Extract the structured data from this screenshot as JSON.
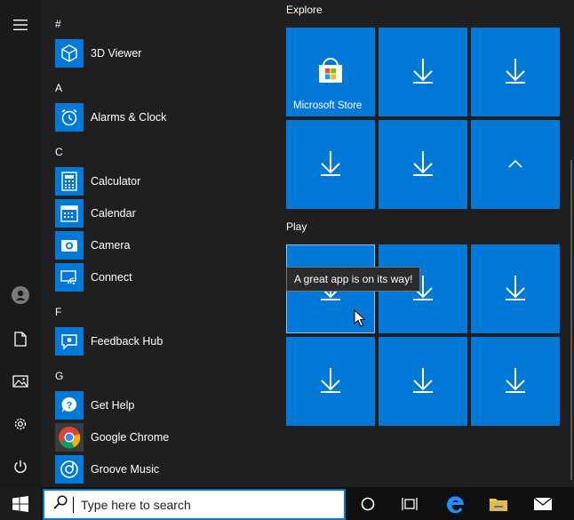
{
  "left_rail": {
    "items": [
      {
        "name": "hamburger-menu-icon"
      },
      {
        "name": "user-avatar-icon"
      },
      {
        "name": "documents-icon"
      },
      {
        "name": "pictures-icon"
      },
      {
        "name": "settings-icon"
      },
      {
        "name": "power-icon"
      }
    ]
  },
  "app_list": {
    "groups": [
      {
        "letter": "#",
        "apps": [
          {
            "label": "3D Viewer",
            "icon": "cube-icon"
          }
        ]
      },
      {
        "letter": "A",
        "apps": [
          {
            "label": "Alarms & Clock",
            "icon": "alarm-clock-icon"
          }
        ]
      },
      {
        "letter": "C",
        "apps": [
          {
            "label": "Calculator",
            "icon": "calculator-icon"
          },
          {
            "label": "Calendar",
            "icon": "calendar-icon"
          },
          {
            "label": "Camera",
            "icon": "camera-icon"
          },
          {
            "label": "Connect",
            "icon": "connect-icon"
          }
        ]
      },
      {
        "letter": "F",
        "apps": [
          {
            "label": "Feedback Hub",
            "icon": "feedback-icon"
          }
        ]
      },
      {
        "letter": "G",
        "apps": [
          {
            "label": "Get Help",
            "icon": "help-icon"
          },
          {
            "label": "Google Chrome",
            "icon": "chrome-icon"
          },
          {
            "label": "Groove Music",
            "icon": "music-icon"
          }
        ]
      }
    ]
  },
  "tiles": {
    "explore": {
      "title": "Explore",
      "items": [
        {
          "label": "Microsoft Store",
          "icon": "store-icon"
        },
        {
          "label": "",
          "icon": "download-arrow-icon"
        },
        {
          "label": "",
          "icon": "download-arrow-icon"
        },
        {
          "label": "",
          "icon": "download-arrow-icon"
        },
        {
          "label": "",
          "icon": "download-arrow-icon"
        },
        {
          "label": "",
          "icon": "chevron-up-icon"
        }
      ]
    },
    "play": {
      "title": "Play",
      "items": [
        {
          "label": "",
          "icon": "download-arrow-icon"
        },
        {
          "label": "",
          "icon": "download-arrow-icon"
        },
        {
          "label": "",
          "icon": "download-arrow-icon"
        },
        {
          "label": "",
          "icon": "download-arrow-icon"
        },
        {
          "label": "",
          "icon": "download-arrow-icon"
        },
        {
          "label": "",
          "icon": "download-arrow-icon"
        }
      ]
    }
  },
  "tooltip": {
    "text": "A great app is on its way!"
  },
  "taskbar": {
    "search_placeholder": "Type here to search",
    "items": [
      "windows-logo-icon",
      "cortana-icon",
      "task-view-icon",
      "edge-icon",
      "file-explorer-icon",
      "mail-icon"
    ]
  },
  "colors": {
    "accent": "#0078d7",
    "menu_bg": "#1f1f1f",
    "taskbar_bg": "#101010"
  }
}
